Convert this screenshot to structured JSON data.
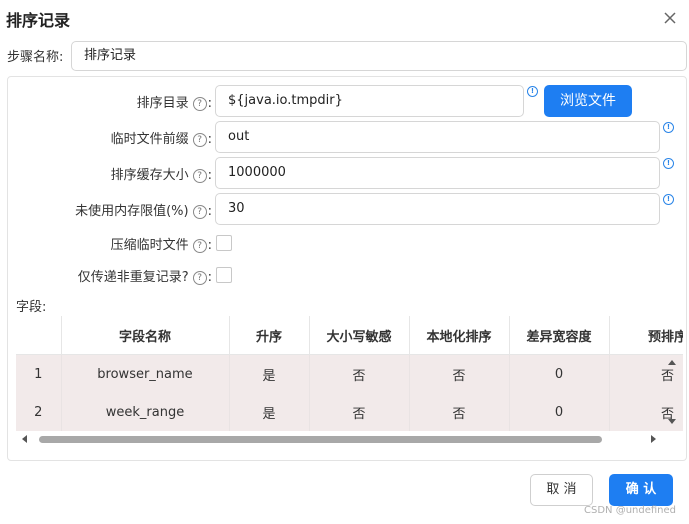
{
  "dialog": {
    "title": "排序记录"
  },
  "step": {
    "label": "步骤名称:",
    "value": "排序记录"
  },
  "form": {
    "sort_dir": {
      "label": "排序目录",
      "value": "${java.io.tmpdir}"
    },
    "temp_prefix": {
      "label": "临时文件前缀",
      "value": "out"
    },
    "cache_size": {
      "label": "排序缓存大小",
      "value": "1000000"
    },
    "free_mem": {
      "label": "未使用内存限值(%)",
      "value": "30"
    },
    "compress": {
      "label": "压缩临时文件",
      "checked": false
    },
    "unique": {
      "label": "仅传递非重复记录?",
      "checked": false
    }
  },
  "help_glyph": "?",
  "colon": ":",
  "info_glyph": "!",
  "browse_button": "浏览文件",
  "fields": {
    "label": "字段:",
    "columns": [
      "",
      "字段名称",
      "升序",
      "大小写敏感",
      "本地化排序",
      "差异宽容度",
      "预排序"
    ],
    "rows": [
      [
        "1",
        "browser_name",
        "是",
        "否",
        "否",
        "0",
        "否"
      ],
      [
        "2",
        "week_range",
        "是",
        "否",
        "否",
        "0",
        "否"
      ]
    ]
  },
  "buttons": {
    "cancel": "取 消",
    "ok": "确 认"
  },
  "watermark": "CSDN @undefined",
  "colors": {
    "primary": "#1e7ef2",
    "row_bg": "#f2eaea"
  }
}
